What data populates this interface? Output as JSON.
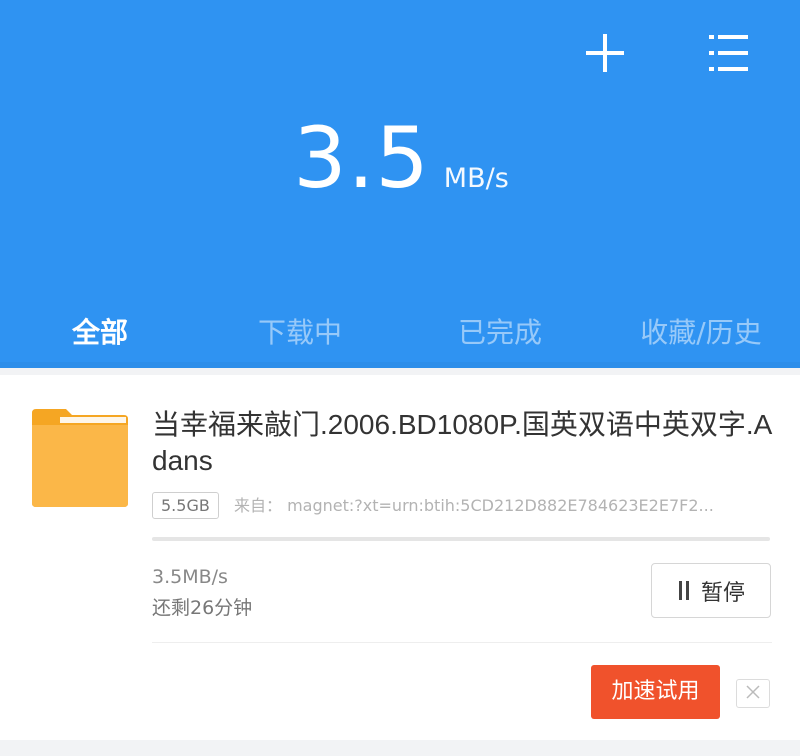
{
  "header": {
    "speed_value": "3.5",
    "speed_unit": "MB/s",
    "add_icon": "plus-icon",
    "menu_icon": "list-menu-icon"
  },
  "tabs": [
    {
      "label": "全部",
      "active": true
    },
    {
      "label": "下载中",
      "active": false
    },
    {
      "label": "已完成",
      "active": false
    },
    {
      "label": "收藏/历史",
      "active": false
    }
  ],
  "task": {
    "icon": "folder-icon",
    "title": "当幸福来敲门.2006.BD1080P.国英双语中英双字.Adans",
    "size": "5.5GB",
    "source": "来自：  magnet:?xt=urn:btih:5CD212D882E784623E2E7F2...",
    "rate": "3.5MB/s",
    "remaining": "还剩26分钟",
    "pause_label": "暂停",
    "boost_label": "加速试用",
    "close_icon": "close-icon"
  },
  "colors": {
    "brand_blue": "#2f93f2",
    "boost_red": "#f0522c",
    "folder_yellow": "#fbb748"
  }
}
